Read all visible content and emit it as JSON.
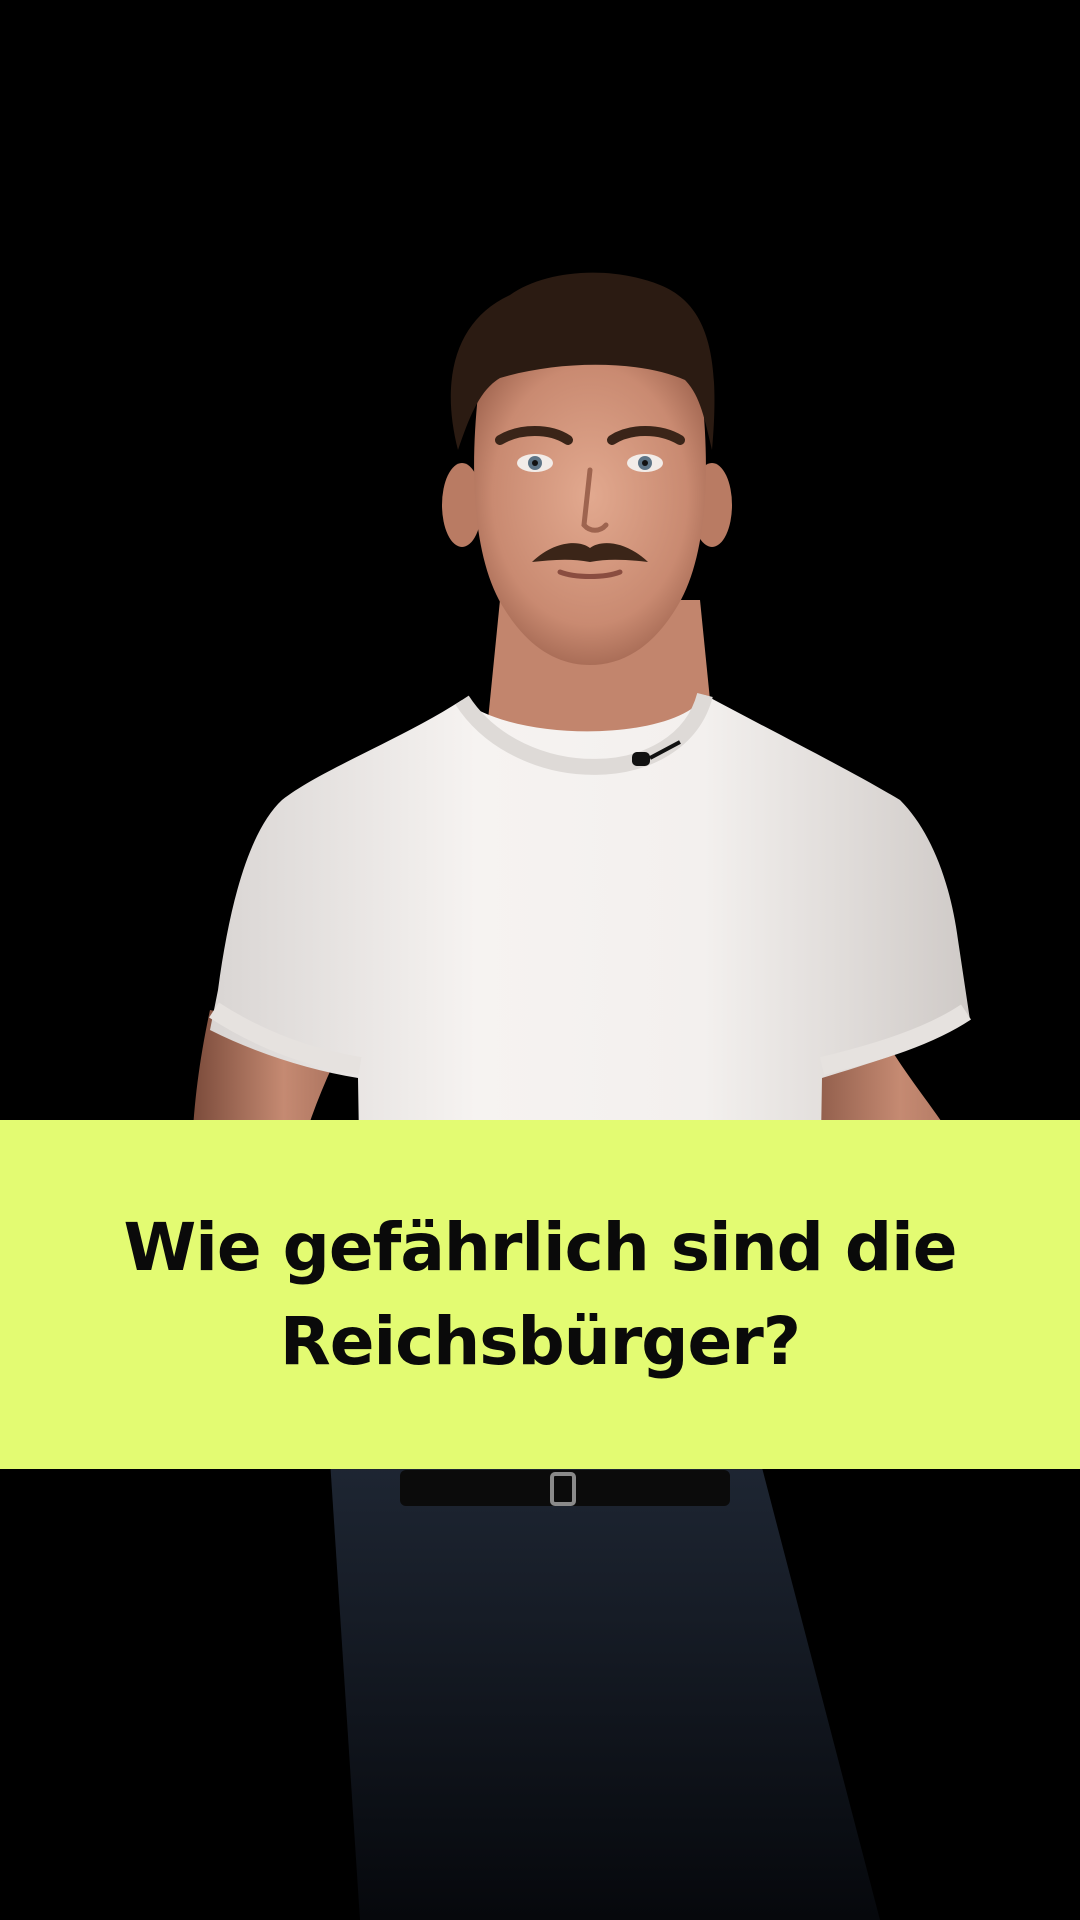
{
  "video": {
    "title_line_1": "Wie gefährlich sind die",
    "title_line_2": "Reichsbürger?"
  },
  "colors": {
    "background": "#000000",
    "banner": "#e3fb72",
    "banner_text": "#0a0a0a",
    "shirt": "#f3f0ee",
    "skin": "#d49a82",
    "hair": "#2b1b12",
    "jeans": "#141b26"
  }
}
